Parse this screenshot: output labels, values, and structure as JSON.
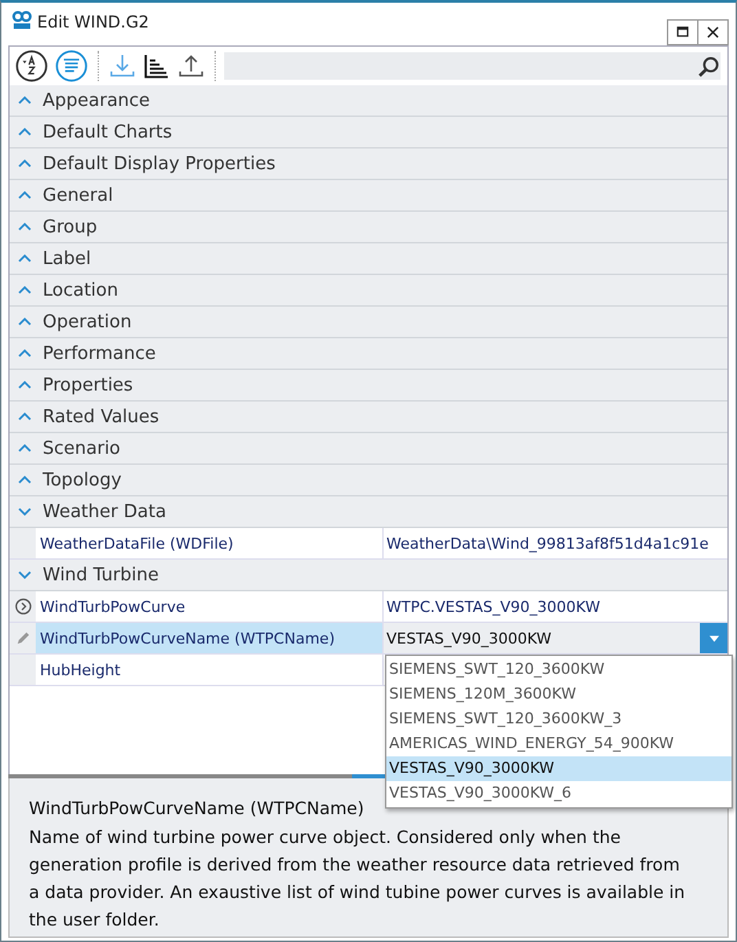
{
  "window": {
    "title": "Edit WIND.G2"
  },
  "categories": [
    {
      "label": "Appearance",
      "expanded": false
    },
    {
      "label": "Default Charts",
      "expanded": false
    },
    {
      "label": "Default Display Properties",
      "expanded": false
    },
    {
      "label": "General",
      "expanded": false
    },
    {
      "label": "Group",
      "expanded": false
    },
    {
      "label": "Label",
      "expanded": false
    },
    {
      "label": "Location",
      "expanded": false
    },
    {
      "label": "Operation",
      "expanded": false
    },
    {
      "label": "Performance",
      "expanded": false
    },
    {
      "label": "Properties",
      "expanded": false
    },
    {
      "label": "Rated Values",
      "expanded": false
    },
    {
      "label": "Scenario",
      "expanded": false
    },
    {
      "label": "Topology",
      "expanded": false
    },
    {
      "label": "Weather Data",
      "expanded": true,
      "rows": [
        {
          "name": "WeatherDataFile (WDFile)",
          "value": "WeatherData\\Wind_99813af8f51d4a1c91e",
          "selected": false,
          "kind": "plain"
        }
      ]
    },
    {
      "label": "Wind Turbine",
      "expanded": true,
      "rows": [
        {
          "name": "WindTurbPowCurve",
          "value": "WTPC.VESTAS_V90_3000KW",
          "selected": false,
          "kind": "linked"
        },
        {
          "name": "WindTurbPowCurveName (WTPCName)",
          "value": "VESTAS_V90_3000KW",
          "selected": true,
          "kind": "editing",
          "dropdown_open": true
        },
        {
          "name": "HubHeight",
          "selected": false,
          "kind": "plain"
        }
      ]
    }
  ],
  "dropdown": {
    "options": [
      {
        "label": "SIEMENS_SWT_120_3600KW",
        "selected": false
      },
      {
        "label": "SIEMENS_120M_3600KW",
        "selected": false
      },
      {
        "label": "SIEMENS_SWT_120_3600KW_3",
        "selected": false
      },
      {
        "label": "AMERICAS_WIND_ENERGY_54_900KW",
        "selected": false
      },
      {
        "label": "VESTAS_V90_3000KW",
        "selected": true
      },
      {
        "label": "VESTAS_V90_3000KW_6",
        "selected": false
      }
    ]
  },
  "description": {
    "title": "WindTurbPowCurveName (WTPCName)",
    "text": "Name of wind turbine power curve object. Considered only when the generation profile is derived from the weather resource data retrieved from a data provider. An exaustive list of wind tubine power curves is available in the user folder."
  }
}
